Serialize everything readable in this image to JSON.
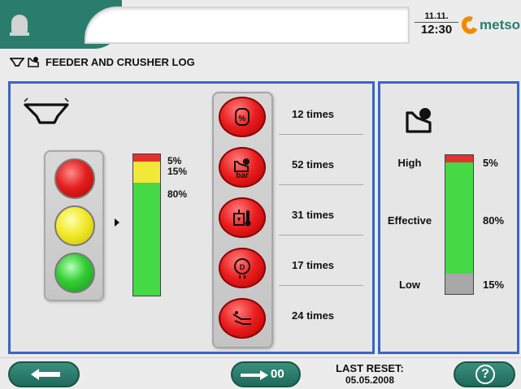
{
  "header": {
    "date": "11.11.",
    "time": "12:30",
    "brand": "metso",
    "brand_color": "#2a7d6d",
    "accent_color": "#f08a00",
    "bell_icon": "alarm-bell-icon"
  },
  "page": {
    "title": "FEEDER AND CRUSHER LOG"
  },
  "feeder_panel": {
    "icon": "feeder-icon",
    "traffic_light": [
      "red",
      "yellow",
      "green"
    ],
    "distribution": [
      {
        "label": "5%",
        "value": 5,
        "color": "#e53030"
      },
      {
        "label": "15%",
        "value": 15,
        "color": "#f2e83a"
      },
      {
        "label": "80%",
        "value": 80,
        "color": "#46d946"
      }
    ],
    "events": [
      {
        "icon": "percent-gauge-icon",
        "sub": "",
        "count": "12 times"
      },
      {
        "icon": "crusher-pressure-icon",
        "sub": "bar",
        "count": "52 times"
      },
      {
        "icon": "oil-temperature-icon",
        "sub": "",
        "count": "31 times"
      },
      {
        "icon": "rotation-speed-icon",
        "sub": "",
        "count": "17 times"
      },
      {
        "icon": "conveyor-icon",
        "sub": "",
        "count": "24 times"
      }
    ]
  },
  "crusher_panel": {
    "icon": "crusher-icon",
    "levels": [
      {
        "label": "High",
        "pct": "5%",
        "value": 5,
        "color": "#e53030"
      },
      {
        "label": "Effective",
        "pct": "80%",
        "value": 80,
        "color": "#46d946"
      },
      {
        "label": "Low",
        "pct": "15%",
        "value": 15,
        "color": "#a8a8a8"
      }
    ]
  },
  "footer": {
    "back_icon": "arrow-left-icon",
    "reset_icon": "arrow-right-icon",
    "reset_button_label": "00",
    "last_reset_label": "LAST RESET:",
    "last_reset_date": "05.05.2008",
    "help_label": "?"
  }
}
